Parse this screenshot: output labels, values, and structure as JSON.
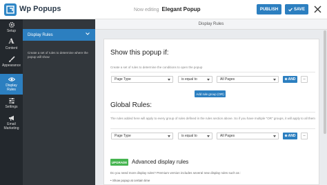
{
  "app": {
    "brand": "Wp Popups"
  },
  "topbar": {
    "editing_label": "Now editing",
    "popup_name": "Elegant Popup",
    "publish_label": "PUBLISH",
    "save_label": "SAVE"
  },
  "rail": [
    {
      "label": "Setup",
      "icon": "gear-icon"
    },
    {
      "label": "Content",
      "icon": "text-icon"
    },
    {
      "label": "Appearance",
      "icon": "brush-icon"
    },
    {
      "label": "Display Rules",
      "icon": "eye-icon",
      "active": true
    },
    {
      "label": "Settings",
      "icon": "sliders-icon"
    },
    {
      "label": "Email Marketing",
      "icon": "megaphone-icon"
    }
  ],
  "panel": {
    "heading": "Display Rules",
    "description": "Create a set of rules to determine where the popup will show"
  },
  "main": {
    "subheader": "Display Rules",
    "show_title": "Show this popup if:",
    "show_desc": "Create a set of rules to determine the conditions to open the popup",
    "rule1": {
      "type": "Page Type",
      "operator": "is equal to",
      "value": "All Pages"
    },
    "and_label": "AND",
    "add_group_label": "Add rule group (OR)",
    "global_title": "Global Rules:",
    "global_desc": "The rules added here will apply to every group of rules defined in the rules section above. So if you have multiple \"OR\" groups, it will apply to all them",
    "rule2": {
      "type": "Page Type",
      "operator": "is equal to",
      "value": "All Pages"
    },
    "upgrade_badge": "UPGRADE",
    "advanced_title": "Advanced display rules",
    "advanced_desc": "Do you need more display rules? Premium version includes several new display rules such as :",
    "advanced_item1": "Show popup at certain time"
  },
  "colors": {
    "accent": "#2c7fc0",
    "rail_bg": "#23282d",
    "panel_bg": "#32373c",
    "upgrade": "#46b450"
  }
}
